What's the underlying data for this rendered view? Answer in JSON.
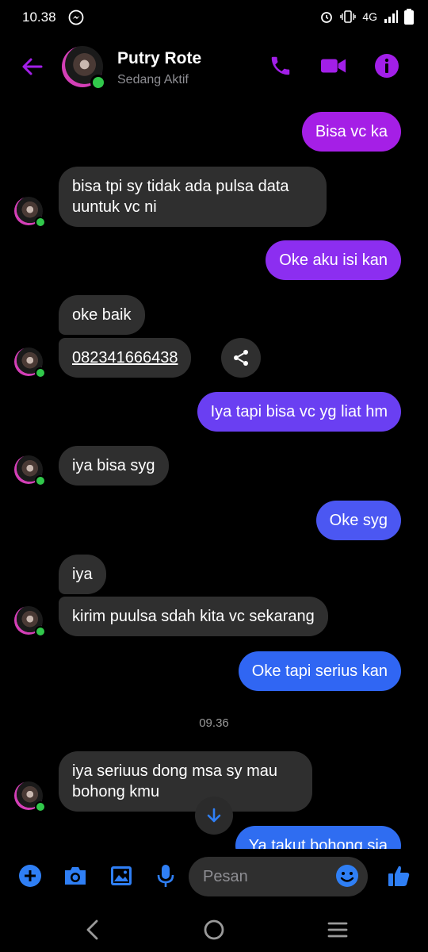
{
  "status_bar": {
    "time": "10.38",
    "network": "4G"
  },
  "header": {
    "name": "Putry Rote",
    "status": "Sedang Aktif"
  },
  "messages": [
    {
      "dir": "out",
      "text": "Bisa vc ka"
    },
    {
      "dir": "in",
      "text": "bisa tpi sy tidak ada pulsa data uuntuk vc ni"
    },
    {
      "dir": "out",
      "text": "Oke aku isi kan"
    },
    {
      "dir": "in",
      "text": "oke baik"
    },
    {
      "dir": "in",
      "text": "082341666438"
    },
    {
      "dir": "out",
      "text": "Iya tapi bisa vc yg liat hm"
    },
    {
      "dir": "in",
      "text": "iya bisa syg"
    },
    {
      "dir": "out",
      "text": "Oke syg"
    },
    {
      "dir": "in",
      "text": "iya"
    },
    {
      "dir": "in",
      "text": "kirim puulsa sdah kita vc sekarang"
    },
    {
      "dir": "out",
      "text": "Oke tapi serius kan"
    },
    {
      "dir": "in",
      "text": "iya seriuus dong msa sy mau bohong kmu"
    },
    {
      "dir": "out",
      "text": "Ya takut bohong sja"
    }
  ],
  "timestamp": "09.36",
  "composer": {
    "placeholder": "Pesan"
  },
  "colors": {
    "accent": "#a21fe8",
    "bubble_out_top": "#a21fe8",
    "bubble_out_bottom": "#2f6df1",
    "bubble_in": "#2f2f2f",
    "online": "#31c84b",
    "composer_icon": "#2f7ff5"
  },
  "icons": {
    "header": [
      "back-arrow-icon",
      "phone-icon",
      "video-camera-icon",
      "info-icon"
    ],
    "composer": [
      "plus-icon",
      "camera-icon",
      "image-icon",
      "microphone-icon",
      "emoji-icon",
      "thumbs-up-icon"
    ],
    "nav": [
      "back-nav-icon",
      "home-nav-icon",
      "recents-nav-icon"
    ]
  }
}
